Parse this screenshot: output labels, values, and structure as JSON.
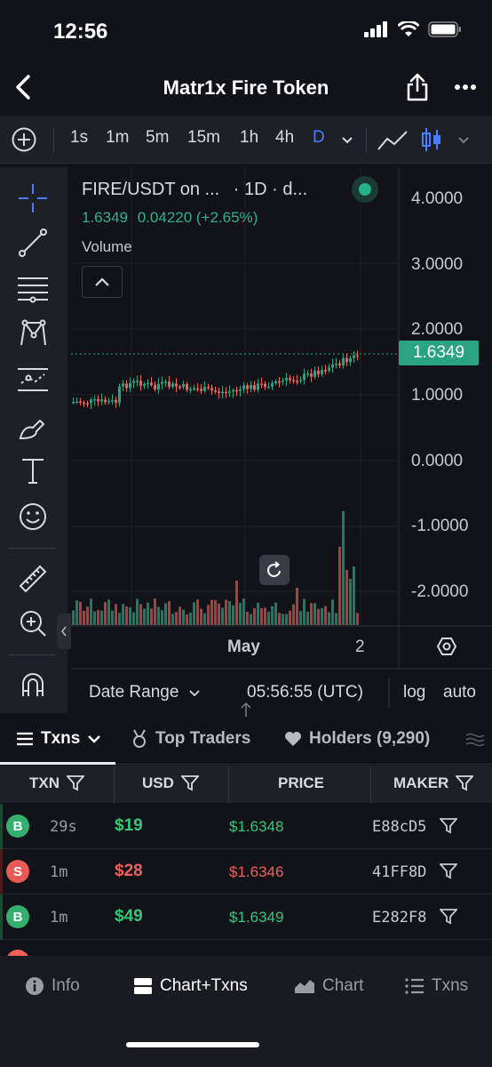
{
  "status_bar": {
    "time": "12:56"
  },
  "header": {
    "title": "Matr1x Fire Token"
  },
  "chart_toolbar": {
    "intervals": [
      "1s",
      "1m",
      "5m",
      "15m",
      "1h",
      "4h",
      "D"
    ],
    "active_interval": "D"
  },
  "chart": {
    "symbol_line": "FIRE/USDT on ...",
    "interval_text": "· 1D · d...",
    "price": "1.6349",
    "change": "0.04220 (+2.65%)",
    "volume_label": "Volume",
    "price_axis": [
      "4.0000",
      "3.0000",
      "2.0000",
      "1.0000",
      "0.0000",
      "-1.0000",
      "-2.0000"
    ],
    "current_price_tag": "1.6349",
    "time_axis": {
      "month": "May",
      "day": "2"
    },
    "date_range_label": "Date Range",
    "utc_time": "05:56:55 (UTC)",
    "log_label": "log",
    "auto_label": "auto",
    "colors": {
      "up": "#2aa383",
      "down": "#f0605b"
    }
  },
  "tabs": {
    "txns": "Txns",
    "top_traders": "Top Traders",
    "holders": "Holders (9,290)"
  },
  "table": {
    "headers": {
      "txn": "TXN",
      "usd": "USD",
      "price": "PRICE",
      "maker": "MAKER"
    },
    "rows": [
      {
        "side": "B",
        "age": "29s",
        "usd": "$19",
        "price": "$1.6348",
        "maker": "E88cD5"
      },
      {
        "side": "S",
        "age": "1m",
        "usd": "$28",
        "price": "$1.6346",
        "maker": "41FF8D"
      },
      {
        "side": "B",
        "age": "1m",
        "usd": "$49",
        "price": "$1.6349",
        "maker": "E282F8"
      }
    ]
  },
  "bottom_nav": {
    "info": "Info",
    "chart_txns": "Chart+Txns",
    "chart": "Chart",
    "txns": "Txns"
  }
}
